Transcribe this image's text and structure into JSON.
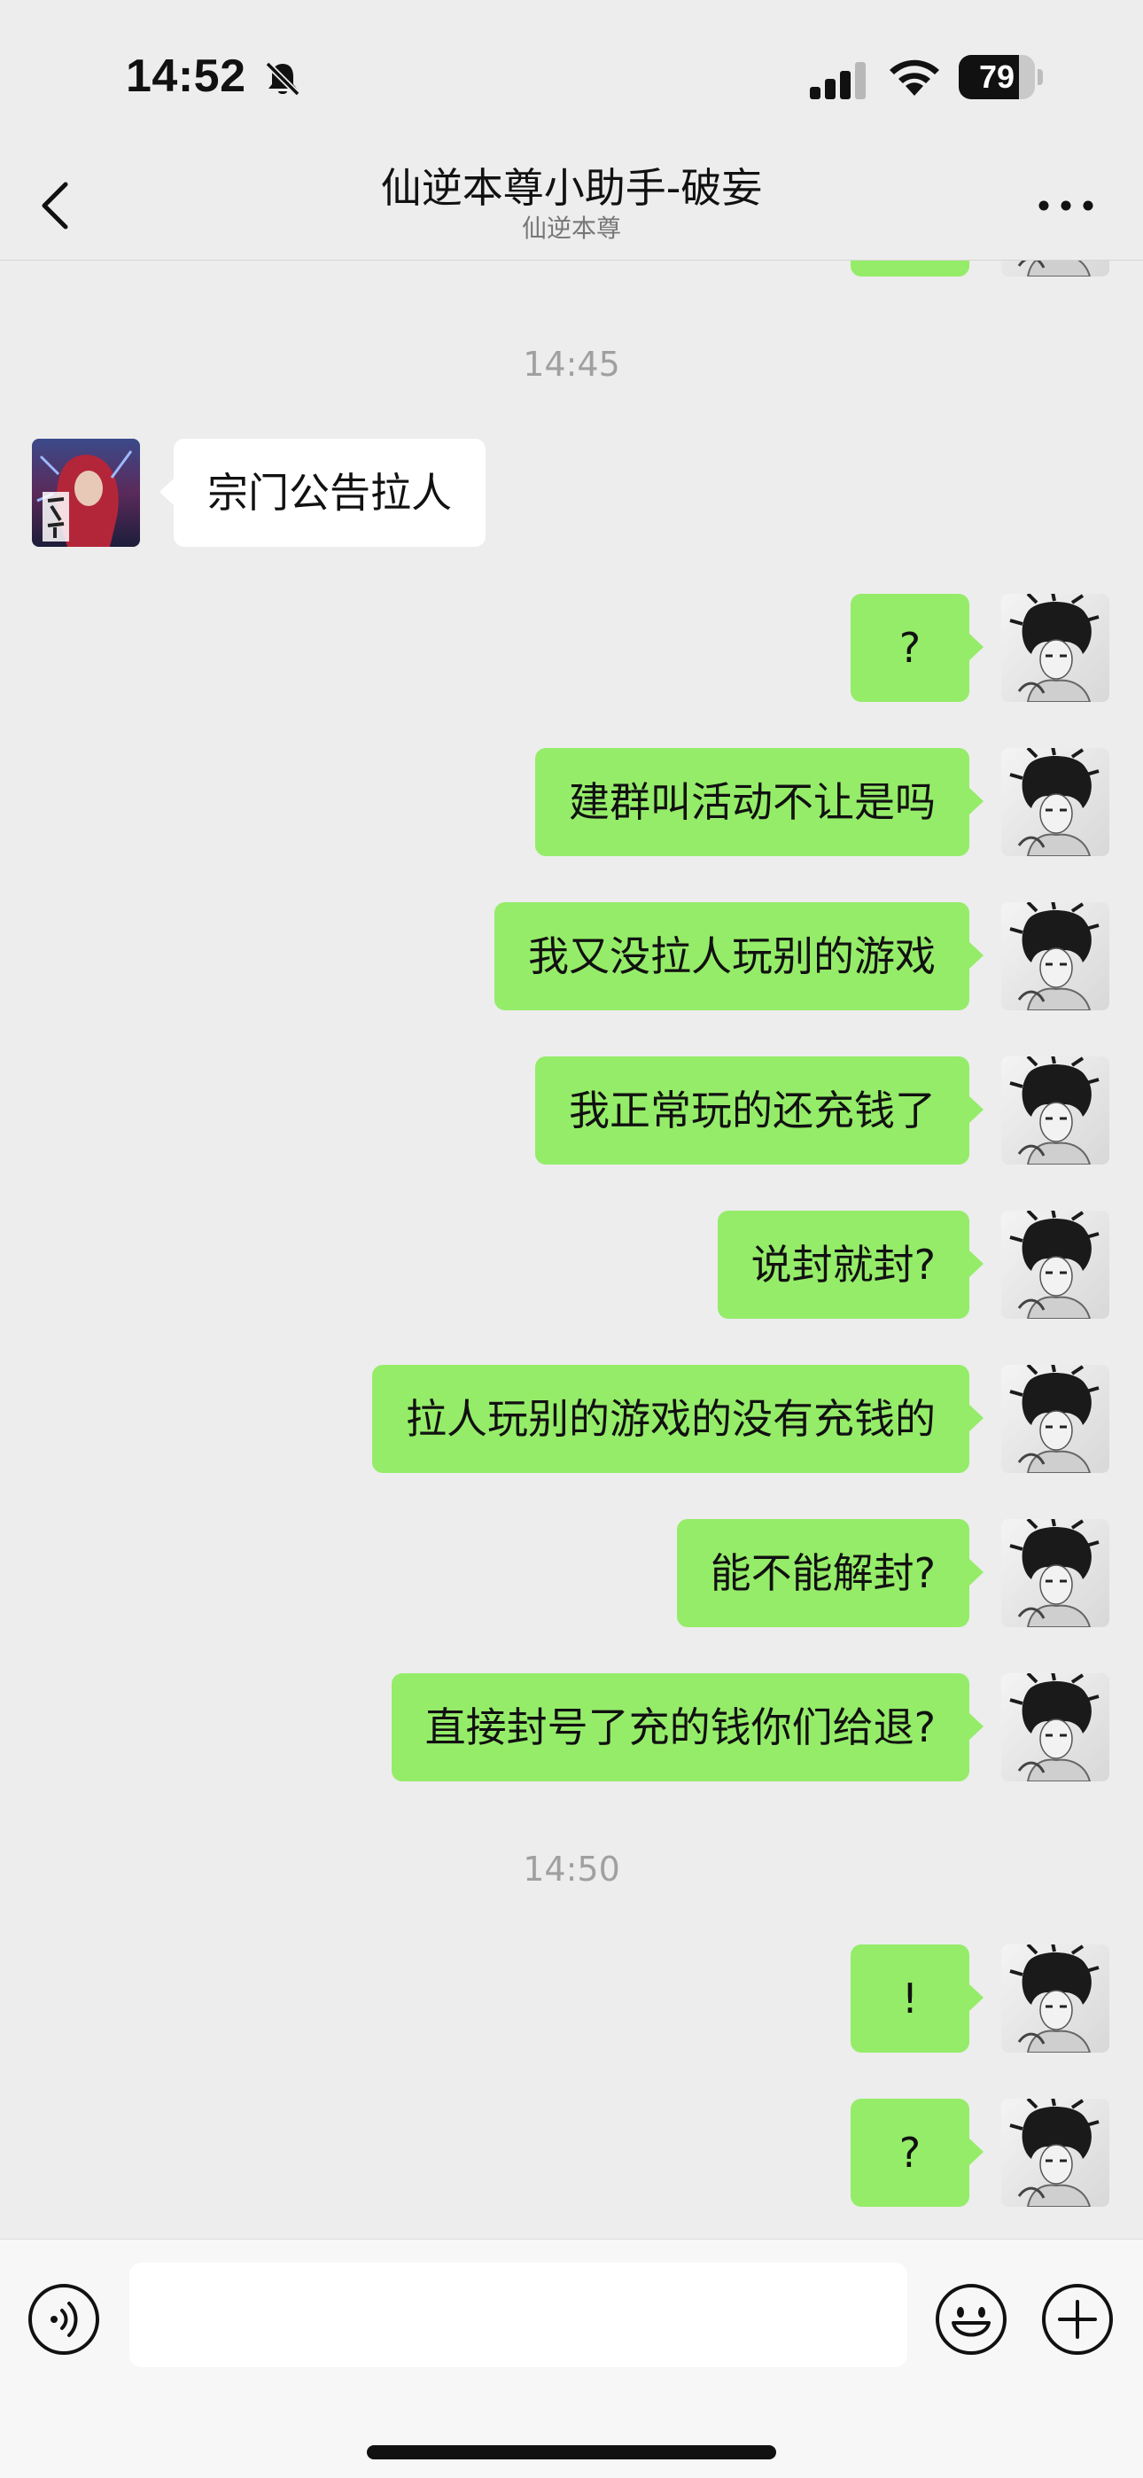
{
  "status_bar": {
    "time": "14:52",
    "battery_level": "79",
    "icons": [
      "bell-slash-icon",
      "signal-icon",
      "wifi-icon",
      "battery-icon"
    ]
  },
  "nav": {
    "title": "仙逆本尊小助手-破妄",
    "subtitle": "仙逆本尊",
    "back_icon": "chevron-left-icon",
    "more_icon": "more-dots-icon"
  },
  "chat": {
    "timestamps": [
      "14:45",
      "14:50"
    ],
    "messages": [
      {
        "side": "in",
        "text": "宗门公告拉人"
      },
      {
        "side": "out",
        "text": "?"
      },
      {
        "side": "out",
        "text": "建群叫活动不让是吗"
      },
      {
        "side": "out",
        "text": "我又没拉人玩别的游戏"
      },
      {
        "side": "out",
        "text": "我正常玩的还充钱了"
      },
      {
        "side": "out",
        "text": "说封就封?"
      },
      {
        "side": "out",
        "text": "拉人玩别的游戏的没有充钱的"
      },
      {
        "side": "out",
        "text": "能不能解封?"
      },
      {
        "side": "out",
        "text": "直接封号了充的钱你们给退?"
      },
      {
        "side": "out",
        "text": "!"
      },
      {
        "side": "out",
        "text": "?"
      }
    ]
  },
  "input_bar": {
    "voice_icon": "voice-icon",
    "input_placeholder": "",
    "emoji_icon": "emoji-icon",
    "plus_icon": "plus-icon"
  },
  "colors": {
    "background": "#ededed",
    "outgoing_bubble": "#95ec69",
    "incoming_bubble": "#ffffff",
    "timestamp_text": "#a0a0a0"
  }
}
